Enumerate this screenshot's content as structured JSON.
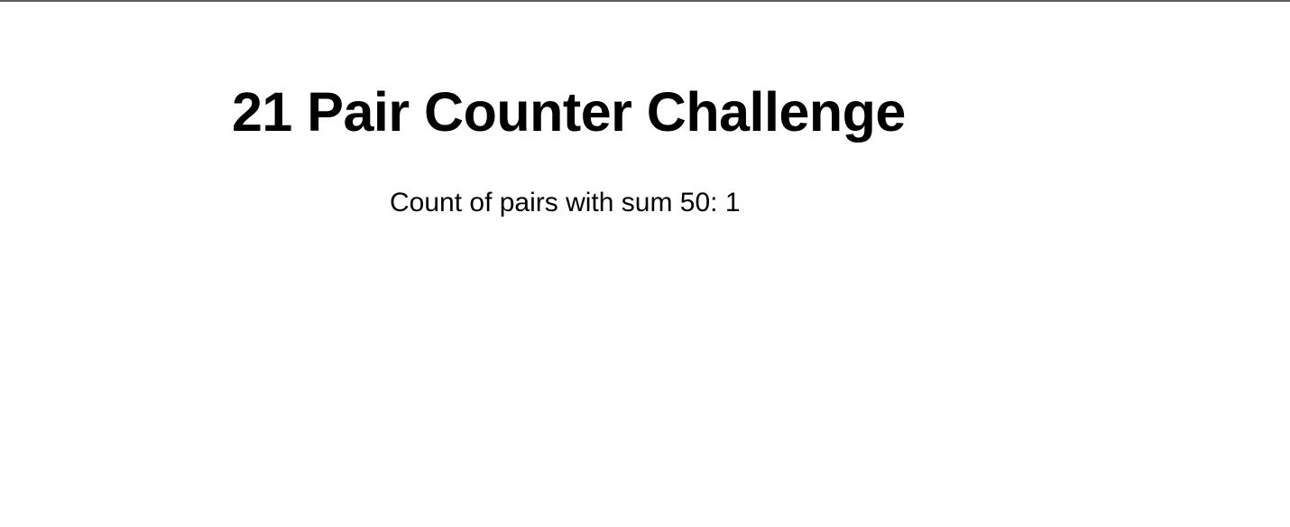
{
  "page": {
    "title": "21 Pair Counter Challenge",
    "result": "Count of pairs with sum 50: 1"
  },
  "colors": {
    "background": "#ffffff",
    "text": "#000000",
    "top_rule": "#5c5c5c"
  }
}
